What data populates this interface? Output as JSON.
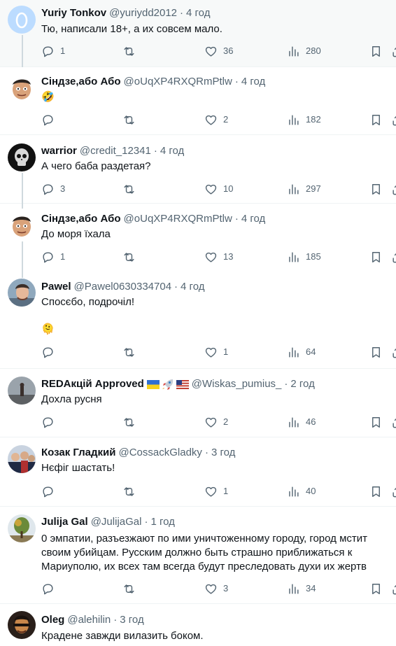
{
  "tweets": [
    {
      "name": "Yuriy Tonkov",
      "handle": "@yuriydd2012",
      "time": "4 год",
      "text": "Тю, написали 18+, а их совсем мало.",
      "reply": "1",
      "retweet": "",
      "like": "36",
      "views": "280",
      "avatar": "default-egg-avatar"
    },
    {
      "name": "Сіндзе,або Або",
      "handle": "@oUqXP4RXQRmPtlw",
      "time": "4 год",
      "text": "🤣",
      "reply": "",
      "retweet": "",
      "like": "2",
      "views": "182",
      "avatar": "caricature-avatar"
    },
    {
      "name": "warrior",
      "handle": "@credit_12341",
      "time": "4 год",
      "text": "А чего баба раздетая?",
      "reply": "3",
      "retweet": "",
      "like": "10",
      "views": "297",
      "avatar": "skull-avatar"
    },
    {
      "name": "Сіндзе,або Або",
      "handle": "@oUqXP4RXQRmPtlw",
      "time": "4 год",
      "text": "До моря їхала",
      "reply": "1",
      "retweet": "",
      "like": "13",
      "views": "185",
      "avatar": "caricature-avatar"
    },
    {
      "name": "Pawel",
      "handle": "@Pawel0630334704",
      "time": "4 год",
      "text": "Спосєбо, подрочіл!",
      "emoji": "🫠",
      "reply": "",
      "retweet": "",
      "like": "1",
      "views": "64",
      "avatar": "portrait-avatar"
    },
    {
      "name": "REDAкцій Approved",
      "handle": "@Wiskas_pumius_",
      "time": "2 год",
      "text": "Дохла русня",
      "reply": "",
      "retweet": "",
      "like": "2",
      "views": "46",
      "avatar": "sky-avatar",
      "flags": [
        "ukraine-flag",
        "rocket",
        "us-flag"
      ]
    },
    {
      "name": "Козак Гладкий",
      "handle": "@CossackGladky",
      "time": "3 год",
      "text": "Нєфіг шастать!",
      "reply": "",
      "retweet": "",
      "like": "1",
      "views": "40",
      "avatar": "group-photo-avatar"
    },
    {
      "name": "Julija Gal",
      "handle": "@JulijaGal",
      "time": "1 год",
      "text": "0 эмпатии, разъезжают по ими уничтоженному городу, город мстит своим убийцам. Русским должно быть страшно приближаться к Мариуполю, их всех там всегда будут преследовать духи их жертв",
      "reply": "",
      "retweet": "",
      "like": "3",
      "views": "34",
      "avatar": "tree-avatar"
    },
    {
      "name": "Oleg",
      "handle": "@alehilin",
      "time": "3 год",
      "text": "Крадене завжди вилазить боком.",
      "avatar": "dark-portrait-avatar"
    }
  ],
  "colors": {
    "text": "#0f1419",
    "secondary": "#536471",
    "border": "#eff3f4",
    "thread": "#cfd9de",
    "egg": "#bcdcff"
  }
}
